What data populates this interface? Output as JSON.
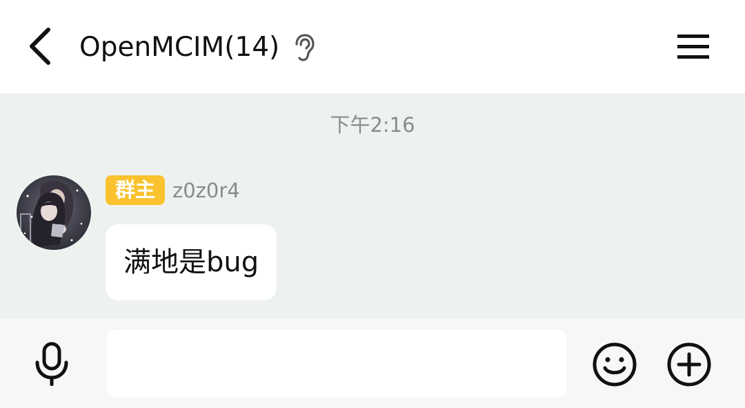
{
  "header": {
    "title": "OpenMCIM(14)",
    "back_icon": "chevron-left-icon",
    "ear_icon": "ear-icon",
    "menu_icon": "hamburger-menu-icon"
  },
  "chat": {
    "timestamp": "下午2:16",
    "messages": [
      {
        "role_badge": "群主",
        "sender": "z0z0r4",
        "text": "满地是bug",
        "avatar": "anime-avatar"
      }
    ]
  },
  "input_bar": {
    "voice_icon": "microphone-icon",
    "input_value": "",
    "emoji_icon": "smiley-icon",
    "more_icon": "plus-circle-icon"
  },
  "colors": {
    "chat_background": "#eef2ef",
    "badge": "#f9c22e",
    "input_bar_background": "#f7f7f7",
    "bubble": "#ffffff"
  }
}
